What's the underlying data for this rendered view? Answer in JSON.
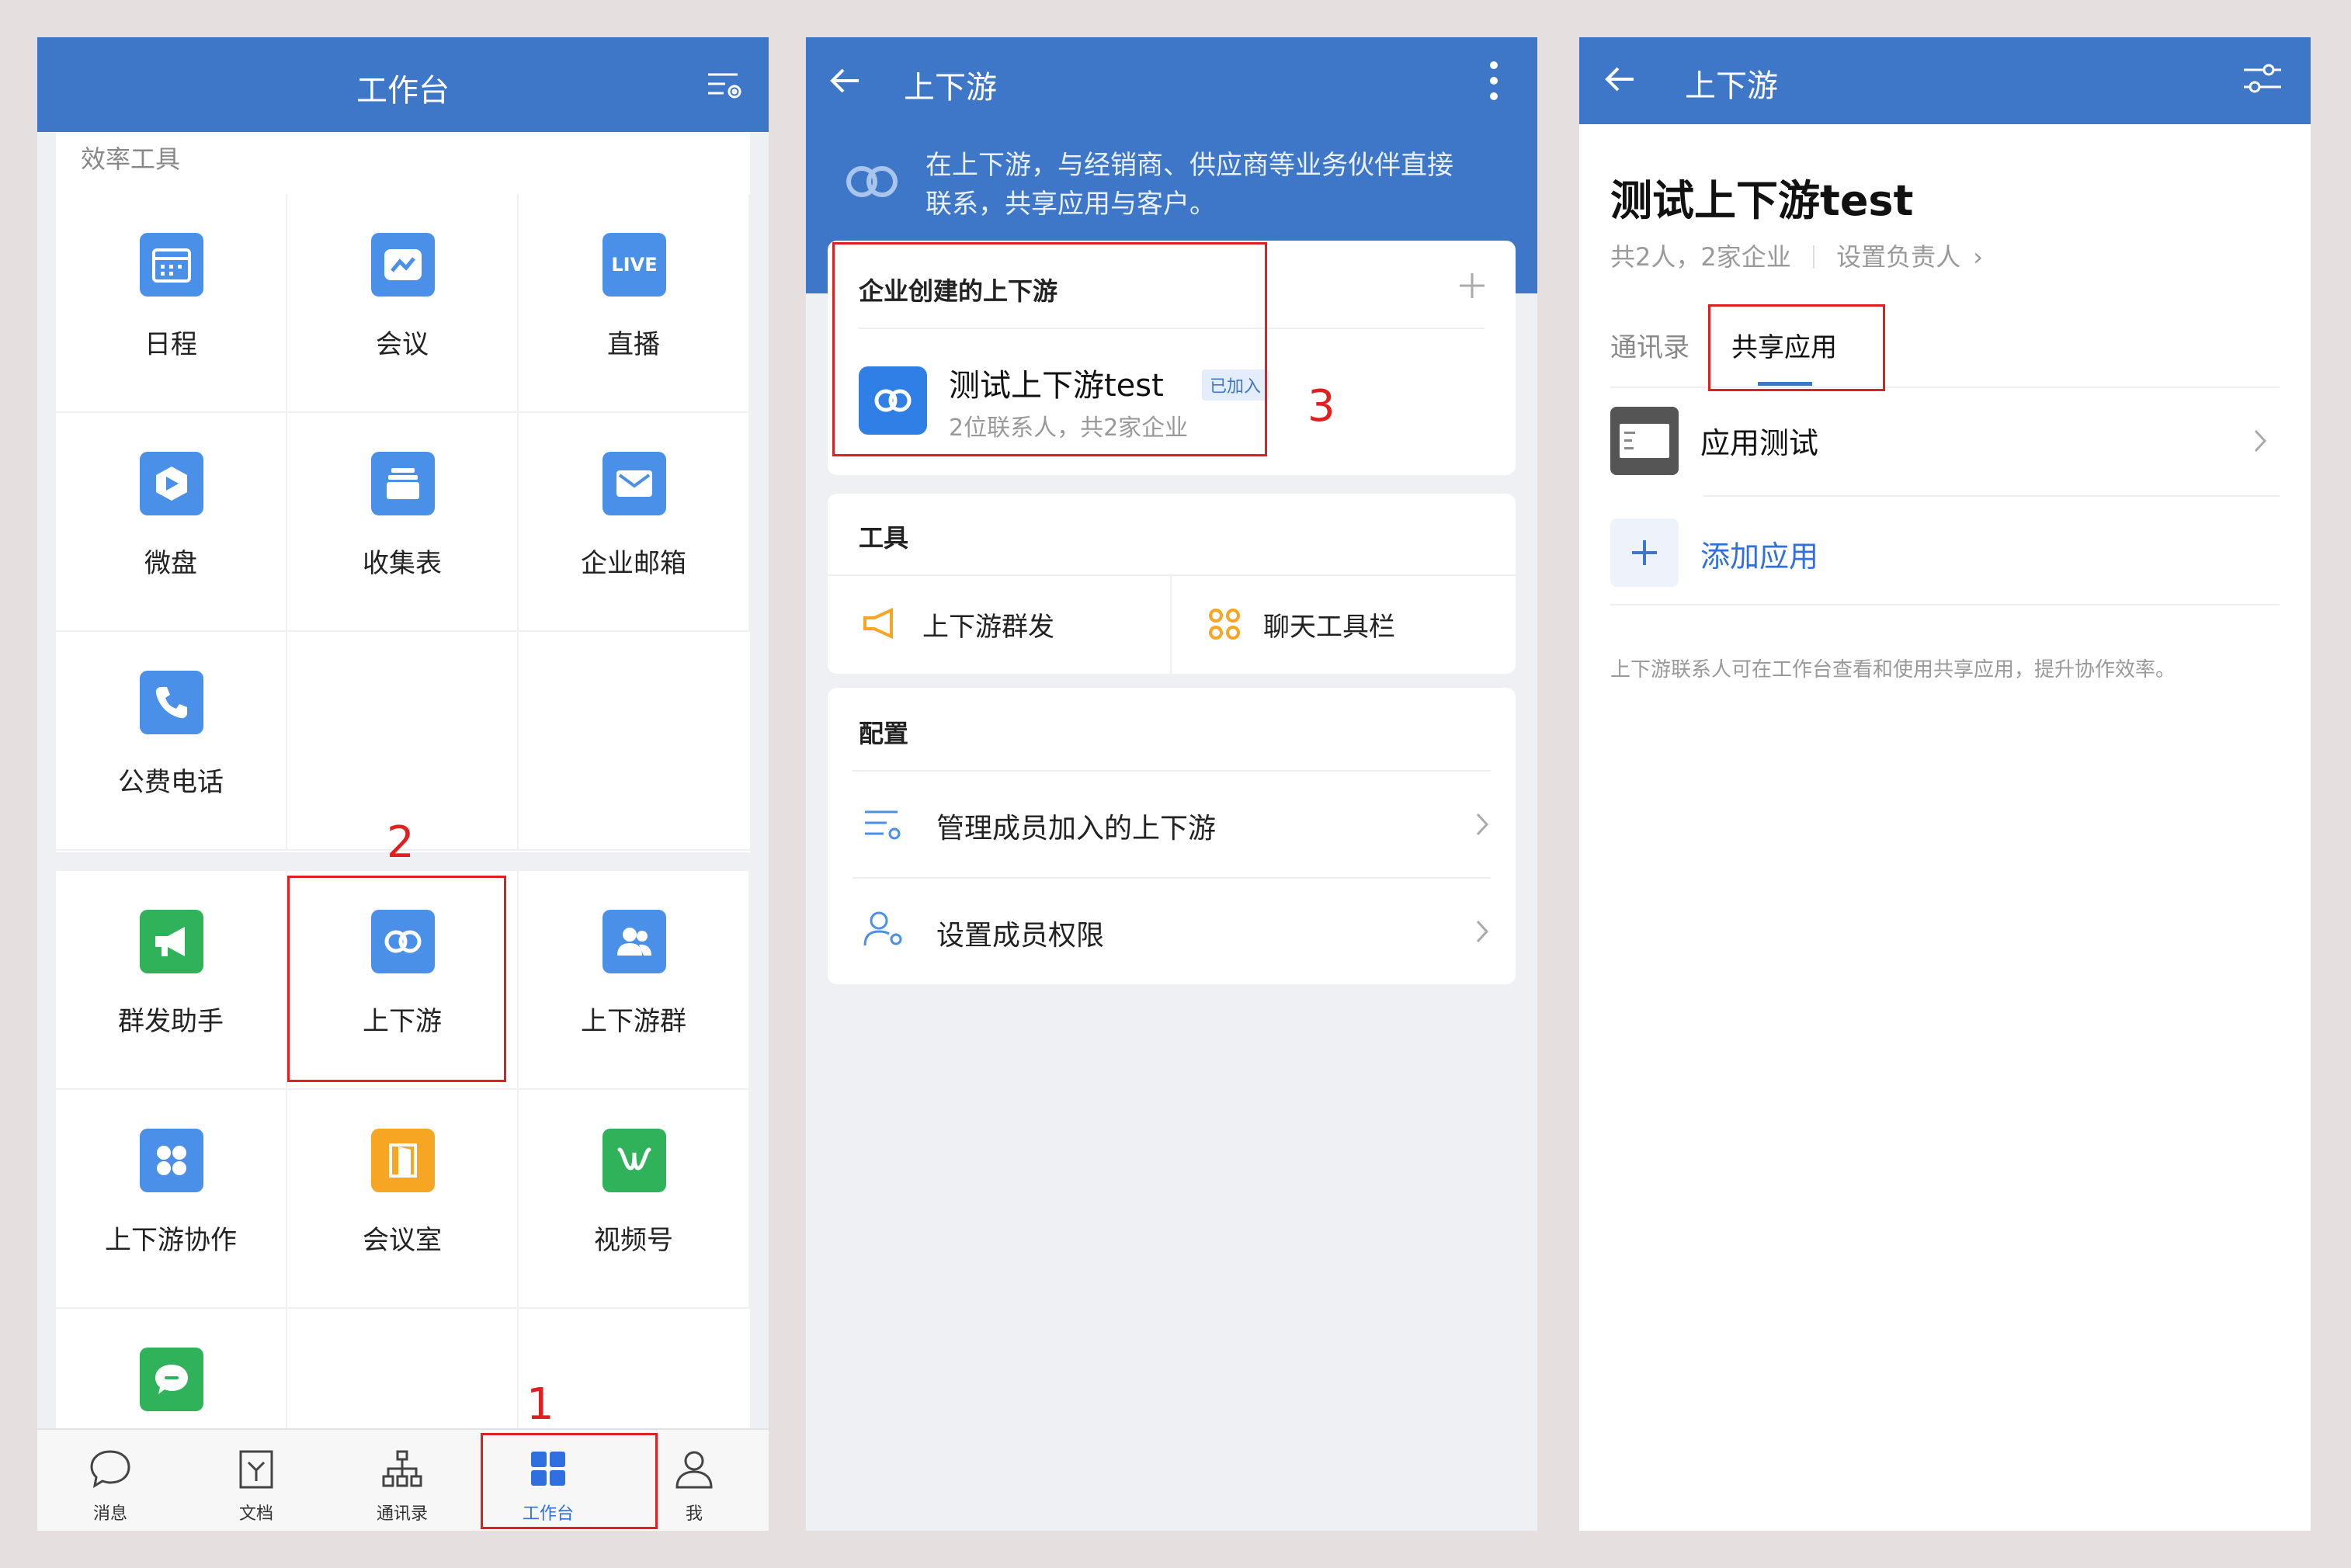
{
  "panel1": {
    "title": "工作台",
    "section_label": "效率工具",
    "apps_top": [
      {
        "label": "日程",
        "icon": "calendar-icon"
      },
      {
        "label": "会议",
        "icon": "meeting-icon"
      },
      {
        "label": "直播",
        "icon": "live-icon",
        "icon_text": "LIVE"
      },
      {
        "label": "微盘",
        "icon": "drive-icon"
      },
      {
        "label": "收集表",
        "icon": "collect-form-icon"
      },
      {
        "label": "企业邮箱",
        "icon": "mail-icon"
      },
      {
        "label": "公费电话",
        "icon": "phone-icon"
      }
    ],
    "apps_bottom": [
      {
        "label": "群发助手",
        "icon": "broadcast-icon"
      },
      {
        "label": "上下游",
        "icon": "link-icon"
      },
      {
        "label": "上下游群",
        "icon": "group-icon"
      },
      {
        "label": "上下游协作",
        "icon": "apps-icon"
      },
      {
        "label": "会议室",
        "icon": "door-icon"
      },
      {
        "label": "视频号",
        "icon": "channels-icon"
      },
      {
        "label": "",
        "icon": "chat-bubble-icon"
      }
    ],
    "tabs": [
      {
        "label": "消息",
        "icon": "message-icon"
      },
      {
        "label": "文档",
        "icon": "document-icon"
      },
      {
        "label": "通讯录",
        "icon": "contacts-icon"
      },
      {
        "label": "工作台",
        "icon": "workbench-icon",
        "active": true
      },
      {
        "label": "我",
        "icon": "profile-icon"
      }
    ],
    "markers": {
      "step1": "1",
      "step2": "2"
    }
  },
  "panel2": {
    "title": "上下游",
    "intro_line1": "在上下游，与经销商、供应商等业务伙伴直接",
    "intro_line2": "联系，共享应用与客户。",
    "created_header": "企业创建的上下游",
    "org_name": "测试上下游test",
    "org_badge": "已加入",
    "org_meta": "2位联系人，共2家企业",
    "tools_header": "工具",
    "tool_broadcast": "上下游群发",
    "tool_chatbar": "聊天工具栏",
    "config_header": "配置",
    "config_manage": "管理成员加入的上下游",
    "config_permission": "设置成员权限",
    "markers": {
      "step3": "3"
    }
  },
  "panel3": {
    "title": "上下游",
    "org_title": "测试上下游test",
    "org_meta": "共2人，2家企业",
    "set_admin": "设置负责人",
    "tab_contacts": "通讯录",
    "tab_shared": "共享应用",
    "app_name": "应用测试",
    "add_app": "添加应用",
    "footer_note": "上下游联系人可在工作台查看和使用共享应用，提升协作效率。"
  },
  "colors": {
    "brand_blue": "#3e77c8",
    "icon_blue": "#4a90e8",
    "marker_red": "#e02020",
    "green": "#2fb25a",
    "orange": "#f6a623"
  }
}
